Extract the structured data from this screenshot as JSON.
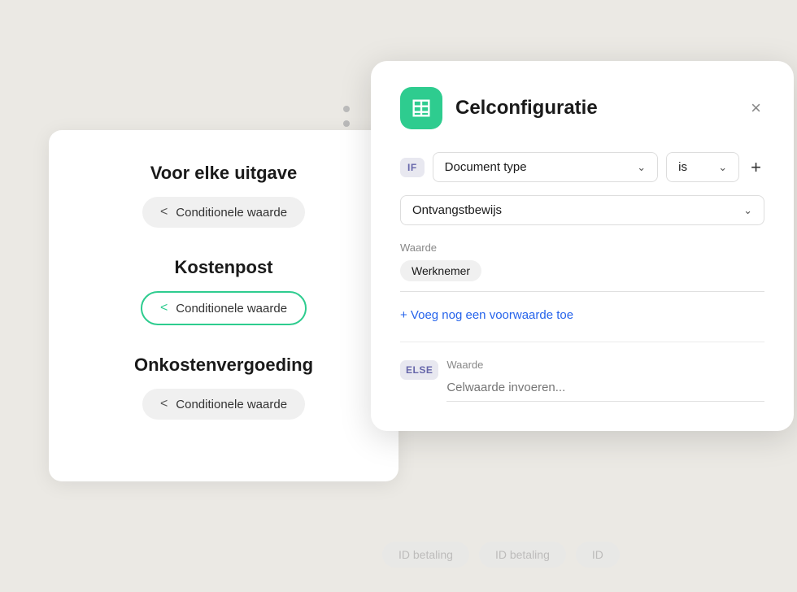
{
  "background": {
    "color": "#ebe9e4"
  },
  "bg_card": {
    "sections": [
      {
        "title": "Voor elke uitgave",
        "btn_label": "Conditionele waarde"
      },
      {
        "title": "Kostenpost",
        "btn_label": "Conditionele waarde",
        "active": true
      },
      {
        "title": "Onkostenvergoeding",
        "btn_label": "Conditionele waarde"
      }
    ]
  },
  "modal": {
    "title": "Celconfiguratie",
    "close_label": "×",
    "if_badge": "IF",
    "else_badge": "ELSE",
    "document_type_label": "Document type",
    "is_label": "is",
    "plus_label": "+",
    "ontvangstbewijs_label": "Ontvangstbewijs",
    "waarde_label": "Waarde",
    "werknemer_chip": "Werknemer",
    "add_condition_label": "+ Voeg nog een voorwaarde toe",
    "else_waarde_label": "Waarde",
    "else_placeholder": "Celwaarde invoeren...",
    "bottom_btns": [
      "ID betaling",
      "ID betaling",
      "ID"
    ]
  },
  "dots": [
    "dot1",
    "dot2",
    "dot3",
    "dot4"
  ]
}
